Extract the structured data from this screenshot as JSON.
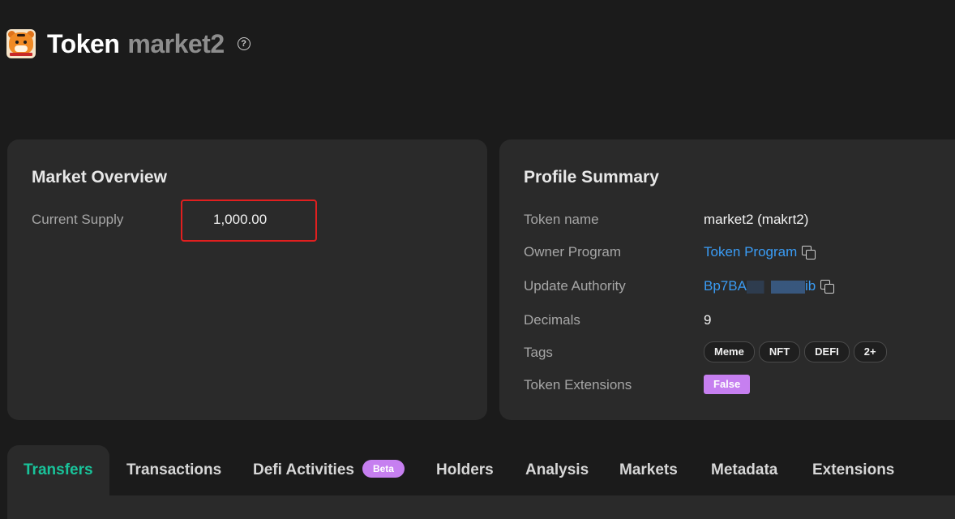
{
  "header": {
    "logo_icon": "tiger-logo",
    "title": "Token",
    "token_name": "market2",
    "help_icon": "question-circle-icon"
  },
  "market_overview": {
    "title": "Market Overview",
    "current_supply_label": "Current Supply",
    "current_supply_value": "1,000.00",
    "highlight_color": "#e11f1f"
  },
  "profile_summary": {
    "title": "Profile Summary",
    "token_name_label": "Token name",
    "token_name_value": "market2 (makrt2)",
    "owner_program_label": "Owner Program",
    "owner_program_value": "Token Program",
    "update_authority_label": "Update Authority",
    "update_authority_prefix": "Bp7BA",
    "update_authority_suffix": "ib",
    "decimals_label": "Decimals",
    "decimals_value": "9",
    "tags_label": "Tags",
    "tags": [
      "Meme",
      "NFT",
      "DEFI",
      "2+"
    ],
    "token_extensions_label": "Token Extensions",
    "token_extensions_value": "False",
    "link_color": "#3a9cf5",
    "badge_color": "#c67ff0"
  },
  "tabs": {
    "items": [
      "Transfers",
      "Transactions",
      "Defi Activities",
      "Holders",
      "Analysis",
      "Markets",
      "Metadata",
      "Extensions"
    ],
    "active": "Transfers",
    "beta_label": "Beta",
    "active_color": "#19c39a"
  }
}
